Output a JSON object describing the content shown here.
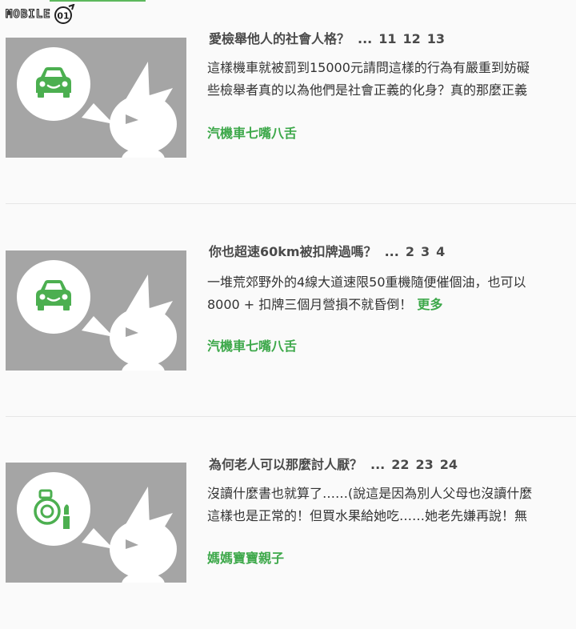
{
  "header": {
    "logo_text": "MOBILE",
    "logo_badge": "01"
  },
  "posts": [
    {
      "title": "愛檢舉他人的社會人格？",
      "ellipsis": "...",
      "pages": [
        "11",
        "12",
        "13"
      ],
      "excerpt_line1": "這樣機車就被罰到15000元請問這樣的行為有嚴重到妨礙",
      "excerpt_line2": "些檢舉者真的以為他們是社會正義的化身？真的那麼正義",
      "more_label": "",
      "category": "汽機車七嘴八舌",
      "icon": "car-icon",
      "colors": {
        "icon": "#4caf50",
        "thumb_bg": "#a5a5a5"
      }
    },
    {
      "title": "你也超速60km被扣牌過嗎？",
      "ellipsis": "...",
      "pages": [
        "2",
        "3",
        "4"
      ],
      "excerpt_line1": "一堆荒郊野外的4線大道速限50重機隨便催個油，也可以",
      "excerpt_line2": "8000 + 扣牌三個月營損不就昏倒！",
      "more_label": "更多",
      "category": "汽機車七嘴八舌",
      "icon": "car-icon",
      "colors": {
        "icon": "#4caf50",
        "thumb_bg": "#a5a5a5"
      }
    },
    {
      "title": "為何老人可以那麼討人厭？",
      "ellipsis": "...",
      "pages": [
        "22",
        "23",
        "24"
      ],
      "excerpt_line1": "沒讀什麼書也就算了……(說這是因為別人父母也沒讀什麼",
      "excerpt_line2": "這樣也是正常的！但買水果給她吃……她老先嫌再說！無",
      "more_label": "",
      "category": "媽媽寶寶親子",
      "icon": "makeup-icon",
      "colors": {
        "icon": "#4caf50",
        "thumb_bg": "#a5a5a5"
      }
    }
  ],
  "colors": {
    "accent": "#3da84a",
    "title": "#4a4a4a",
    "divider": "#e6e6e6"
  }
}
